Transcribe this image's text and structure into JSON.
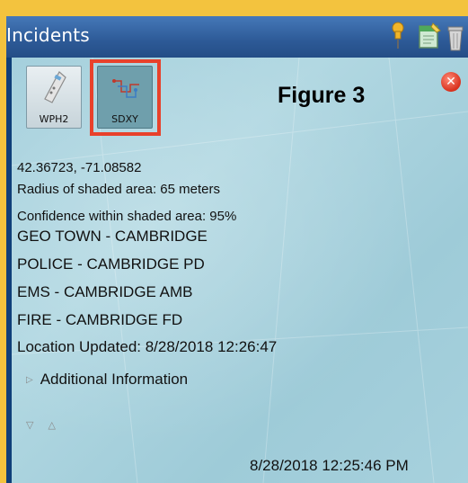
{
  "window": {
    "title": "Incidents",
    "icons": [
      "pin-icon",
      "notes-icon",
      "trash-icon"
    ]
  },
  "tabs": [
    {
      "label": "WPH2",
      "icon": "phone-icon",
      "active": false
    },
    {
      "label": "SDXY",
      "icon": "map-route-icon",
      "active": true
    }
  ],
  "annotation": {
    "label": "Figure 3",
    "highlight_color": "#e8412b"
  },
  "details": {
    "coordinates": "42.36723, -71.08582",
    "radius": "Radius of shaded area: 65 meters",
    "confidence": "Confidence within shaded area: 95%",
    "geo_town": "GEO TOWN - CAMBRIDGE",
    "police": "POLICE - CAMBRIDGE PD",
    "ems": "EMS - CAMBRIDGE AMB",
    "fire": "FIRE - CAMBRIDGE FD",
    "location_updated": "Location Updated: 8/28/2018  12:26:47"
  },
  "additional_info_label": "Additional Information",
  "footer_timestamp": "8/28/2018  12:25:46 PM",
  "colors": {
    "background": "#f3c33e",
    "window_frame": "#0f3f79",
    "panel": "#a7d1dd"
  }
}
